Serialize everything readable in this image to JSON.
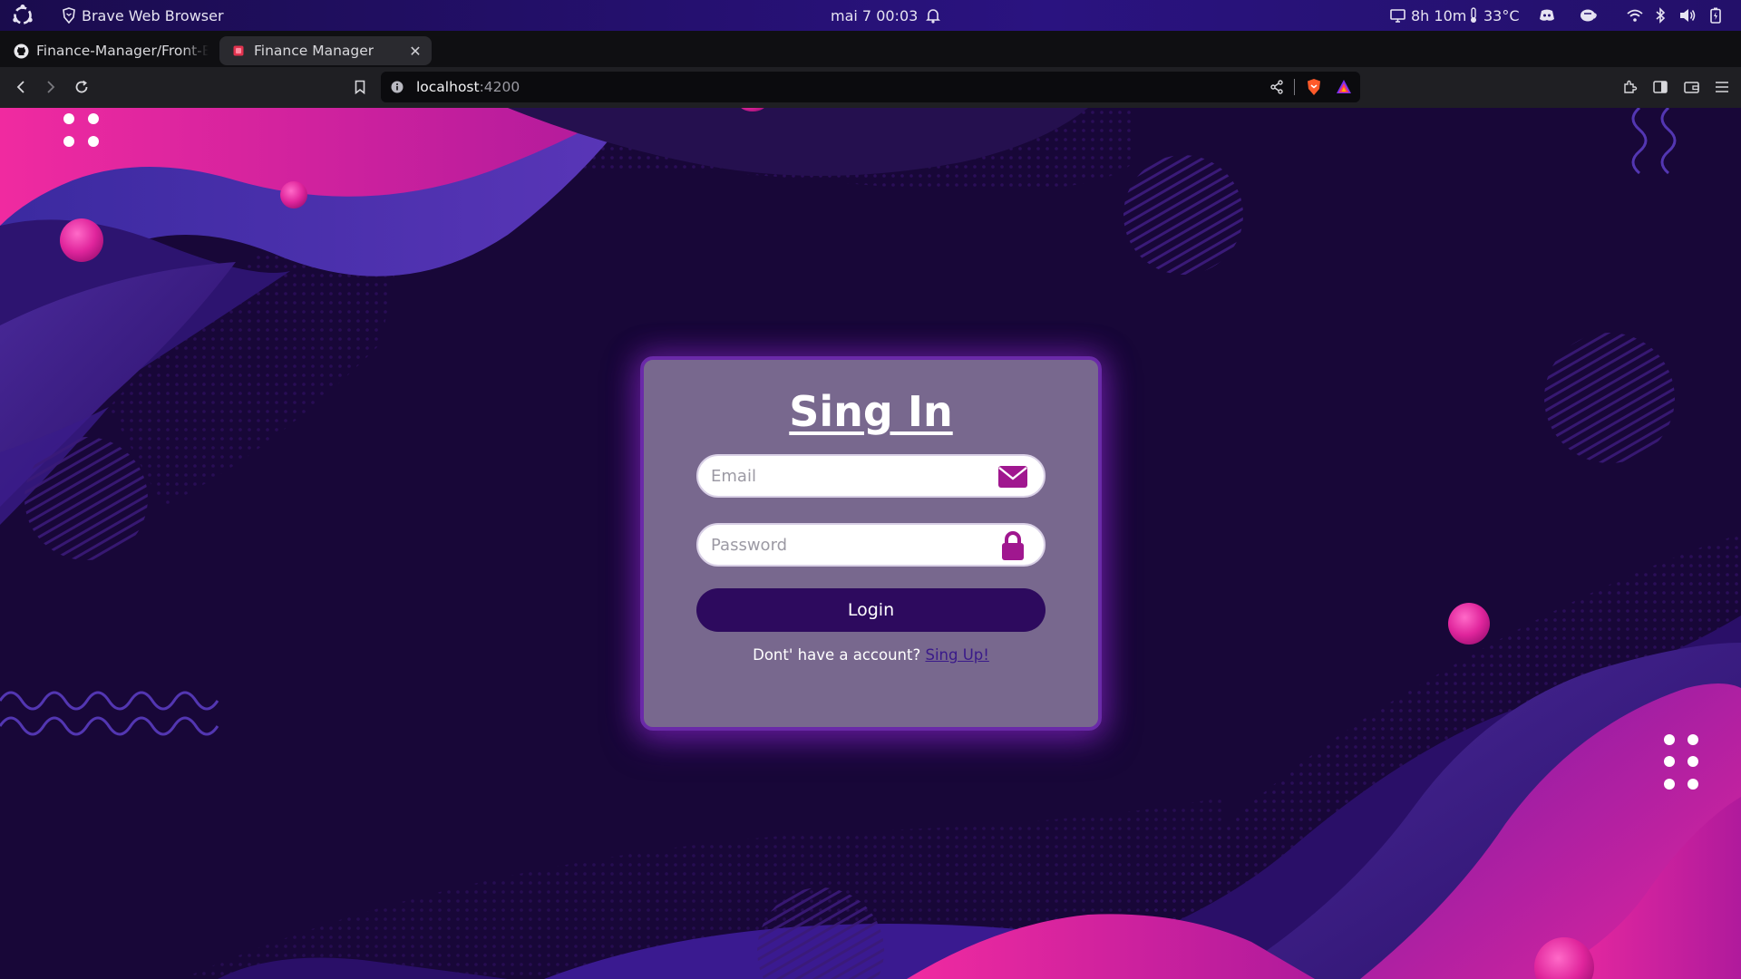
{
  "system_bar": {
    "app_name": "Brave Web Browser",
    "datetime": "mai 7  00:03",
    "screen_time": "8h 10m",
    "temperature": "33°C"
  },
  "browser": {
    "tabs": [
      {
        "label": "Finance-Manager/Front-End",
        "active": false,
        "icon": "github-icon"
      },
      {
        "label": "Finance Manager",
        "active": true,
        "icon": "app-favicon"
      }
    ],
    "url_host": "localhost",
    "url_port": ":4200"
  },
  "login": {
    "title": "Sing In",
    "email_placeholder": "Email",
    "password_placeholder": "Password",
    "login_label": "Login",
    "signup_prompt": "Dont' have a account? ",
    "signup_link": "Sing Up!"
  },
  "colors": {
    "page_background": "#180738",
    "accent_magenta": "#e0259c",
    "card_border": "#6a2aa8",
    "button": "#2d0a5e",
    "icon_purple": "#a0178f"
  }
}
